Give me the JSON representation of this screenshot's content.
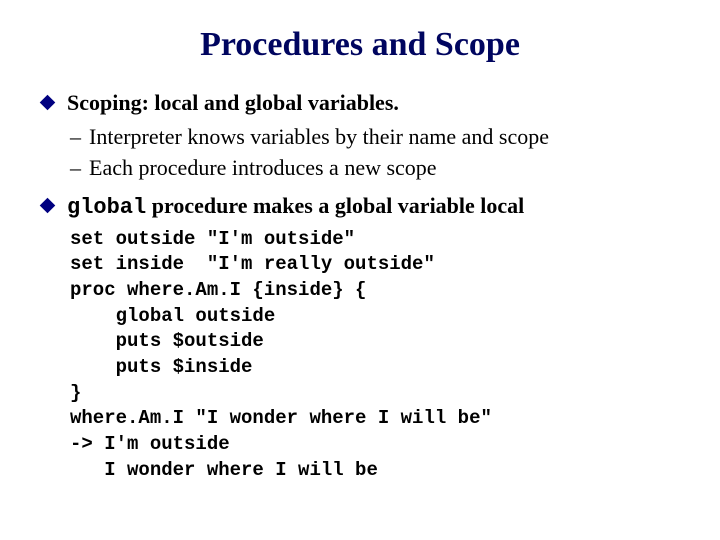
{
  "title": "Procedures and Scope",
  "bullets": [
    {
      "text": "Scoping: local and global variables.",
      "subs": [
        "Interpreter knows variables by their name and scope",
        "Each procedure introduces a new scope"
      ]
    },
    {
      "code_prefix": "global",
      "text_suffix": " procedure makes a global variable local"
    }
  ],
  "code": "set outside \"I'm outside\"\nset inside  \"I'm really outside\"\nproc where.Am.I {inside} {\n    global outside\n    puts $outside\n    puts $inside\n}\nwhere.Am.I \"I wonder where I will be\"\n-> I'm outside\n   I wonder where I will be"
}
